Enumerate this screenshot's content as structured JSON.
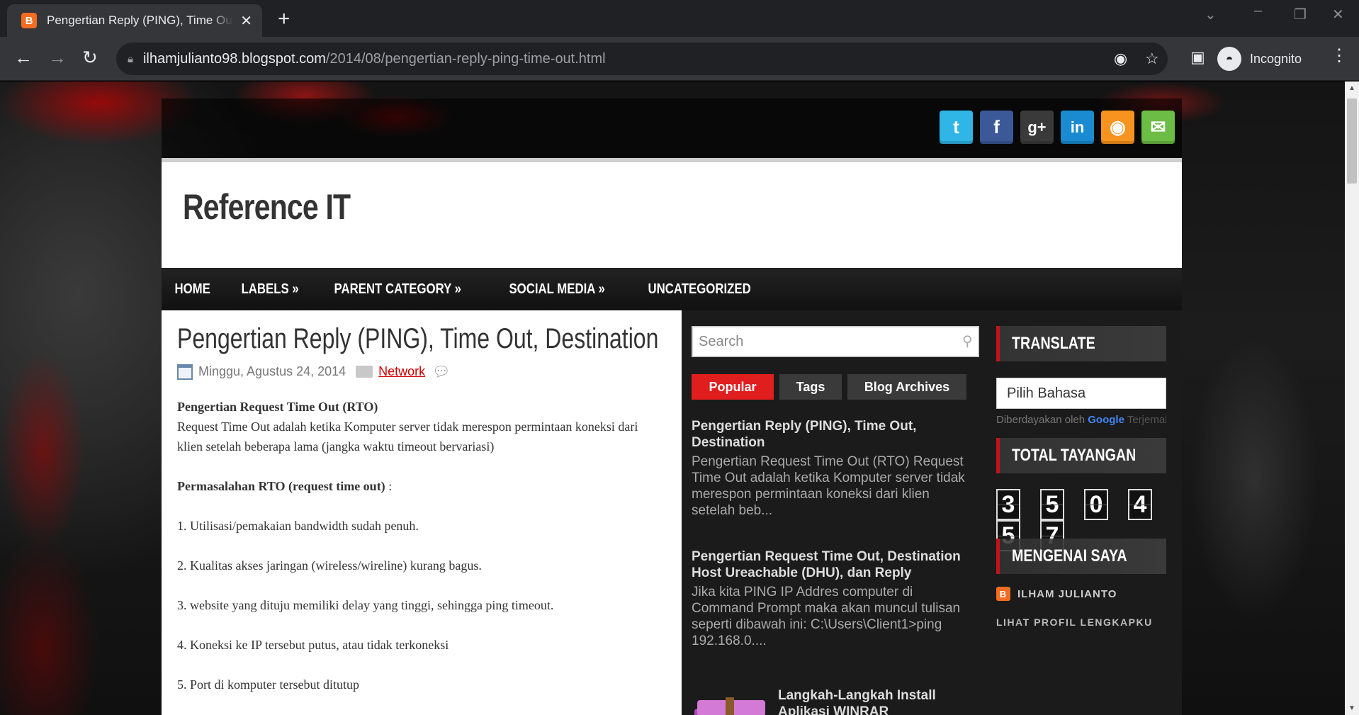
{
  "browser": {
    "tab_title": "Pengertian Reply (PING), Time Out, Destination",
    "tab_favicon": "B",
    "url_host": "ilhamjulianto98.blogspot.com",
    "url_path": "/2014/08/pengertian-reply-ping-time-out.html",
    "profile_label": "Incognito"
  },
  "social_icons": [
    {
      "name": "twitter-icon",
      "glyph": "t",
      "color": "#2fb5e6"
    },
    {
      "name": "facebook-icon",
      "glyph": "f",
      "color": "#3b5998"
    },
    {
      "name": "google-plus-icon",
      "glyph": "g+",
      "color": "#3a3a3a"
    },
    {
      "name": "linkedin-icon",
      "glyph": "in",
      "color": "#1a8bd0"
    },
    {
      "name": "rss-icon",
      "glyph": "◉",
      "color": "#f7931e"
    },
    {
      "name": "email-icon",
      "glyph": "✉",
      "color": "#6cbd45"
    }
  ],
  "site": {
    "title": "Reference IT"
  },
  "nav": [
    {
      "label": "HOME"
    },
    {
      "label": "LABELS »"
    },
    {
      "label": "PARENT CATEGORY »"
    },
    {
      "label": "SOCIAL MEDIA »"
    },
    {
      "label": "UNCATEGORIZED"
    }
  ],
  "post": {
    "title": "Pengertian Reply (PING), Time Out, Destination",
    "date": "Minggu, Agustus 24, 2014",
    "label": "Network",
    "heading1": "Pengertian Request Time Out (RTO)",
    "para1": "Request Time Out adalah ketika Komputer server tidak merespon permintaan koneksi dari klien setelah beberapa lama (jangka waktu timeout bervariasi)",
    "heading2": "Permasalahan RTO (request time out)",
    "heading2_suffix": " :",
    "items": [
      "1. Utilisasi/pemakaian bandwidth sudah penuh.",
      "2. Kualitas akses jaringan (wireless/wireline) kurang bagus.",
      "3. website yang dituju memiliki delay yang tinggi, sehingga ping timeout.",
      "4. Koneksi ke IP tersebut putus, atau tidak terkoneksi",
      "5. Port di komputer tersebut ditutup"
    ]
  },
  "sidebar": {
    "search_placeholder": "Search",
    "tabs": [
      {
        "label": "Popular",
        "active": true
      },
      {
        "label": "Tags",
        "active": false
      },
      {
        "label": "Blog Archives",
        "active": false
      }
    ],
    "popular": [
      {
        "title": "Pengertian Reply (PING), Time Out, Destination",
        "snippet": "Pengertian Request Time Out (RTO) Request Time Out adalah ketika Komputer server tidak merespon permintaan koneksi dari klien setelah beb..."
      },
      {
        "title": "Pengertian Request Time Out, Destination Host Ureachable (DHU), dan Reply",
        "snippet": "Jika kita PING IP Addres computer di Command Prompt maka akan muncul tulisan seperti dibawah ini: C:\\Users\\Client1>ping 192.168.0...."
      },
      {
        "title": "Langkah-Langkah Install Aplikasi WINRAR",
        "snippet": ""
      }
    ]
  },
  "right": {
    "translate_title": "TRANSLATE",
    "lang_select": "Pilih Bahasa",
    "powered_by": "Diberdayakan oleh",
    "powered_brand": "Google",
    "powered_rest": "Terjemahan",
    "views_title": "TOTAL TAYANGAN",
    "digits": [
      "3",
      "5",
      "0",
      "4",
      "5",
      "7"
    ],
    "about_title": "MENGENAI SAYA",
    "author": "ILHAM JULIANTO",
    "profile_link": "LIHAT PROFIL LENGKAPKU"
  },
  "colors": {
    "accent_red": "#e01e1e",
    "tab_inactive": "#3a3a3a"
  }
}
